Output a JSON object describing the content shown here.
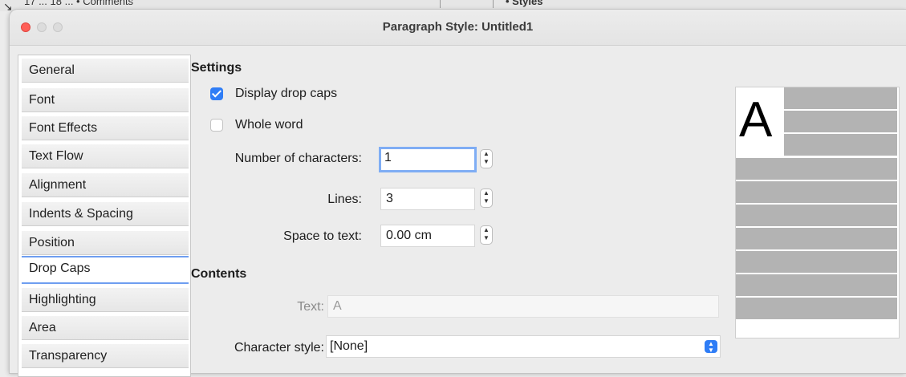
{
  "background": {
    "left_text": "17 ... 18 ... • Comments",
    "right_text": "• Styles"
  },
  "window": {
    "title": "Paragraph Style: Untitled1"
  },
  "tabs": [
    {
      "label": "General"
    },
    {
      "label": "Font"
    },
    {
      "label": "Font Effects"
    },
    {
      "label": "Text Flow"
    },
    {
      "label": "Alignment"
    },
    {
      "label": "Indents & Spacing"
    },
    {
      "label": "Position"
    },
    {
      "label": "Drop Caps",
      "active": true
    },
    {
      "label": "Highlighting"
    },
    {
      "label": "Area"
    },
    {
      "label": "Transparency"
    }
  ],
  "settings": {
    "title": "Settings",
    "display_drop_caps": {
      "label": "Display drop caps",
      "checked": true
    },
    "whole_word": {
      "label": "Whole word",
      "checked": false
    },
    "num_chars": {
      "label": "Number of characters:",
      "value": "1"
    },
    "lines": {
      "label": "Lines:",
      "value": "3"
    },
    "space": {
      "label": "Space to text:",
      "value": "0.00 cm"
    }
  },
  "contents": {
    "title": "Contents",
    "text": {
      "label": "Text:",
      "value": "A"
    },
    "char_style": {
      "label": "Character style:",
      "value": "[None]"
    }
  },
  "preview": {
    "letter": "A"
  },
  "colors": {
    "accent": "#2f7df6",
    "focus": "#7fadf4",
    "close": "#ff5f57",
    "preview_line": "#b3b3b3"
  },
  "icons": {
    "spin": "up-down-stepper-icon",
    "select": "chevron-up-down-icon",
    "check": "checkmark-icon"
  }
}
